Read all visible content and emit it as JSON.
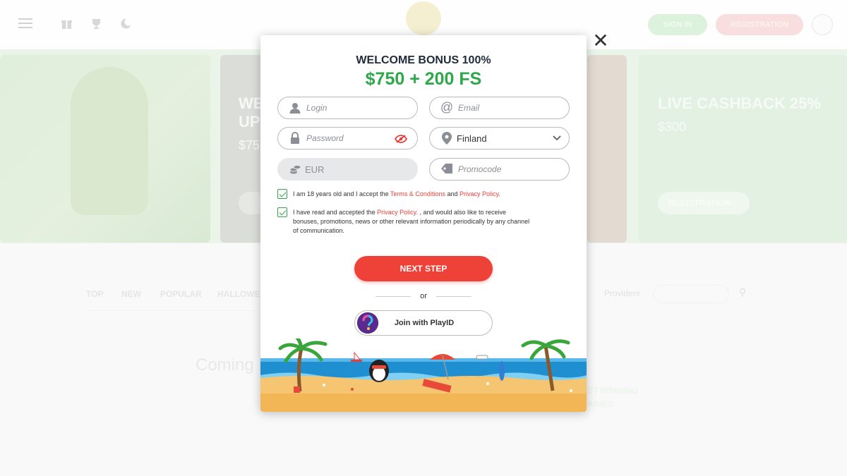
{
  "header": {
    "signin_label": "SIGN IN",
    "registration_label": "REGISTRATION"
  },
  "banners": {
    "b2_title_line1": "WE",
    "b2_title_line2": "UP",
    "b2_amount": "$75",
    "b4_title": "LIVE CASHBACK 25%",
    "b4_amount": "$300",
    "b4_button": "REGISTRATION"
  },
  "games": {
    "tabs": [
      "TOP",
      "NEW",
      "POPULAR",
      "HALLOWE"
    ],
    "providers_label": "Providers",
    "coming_text": "Coming",
    "winning_line1": "ST WINNING",
    "winning_line2": "ABIES"
  },
  "modal": {
    "title": "WELCOME BONUS 100%",
    "amount": "$750 + 200 FS",
    "fields": {
      "login_placeholder": "Login",
      "email_placeholder": "Email",
      "password_placeholder": "Password",
      "country_value": "Finland",
      "currency_value": "EUR",
      "promocode_placeholder": "Promocode"
    },
    "consent1": {
      "prefix": "I am 18 years old and I accept the ",
      "terms_link": "Terms & Conditions",
      "middle": " and ",
      "privacy_link": "Privacy Policy."
    },
    "consent2": {
      "prefix": "I have read and accepted the ",
      "privacy_link": "Privacy Policy.",
      "suffix": " , and would also like to receive bonuses, promotions, news or other relevant information periodically by any channel of communication."
    },
    "next_label": "NEXT STEP",
    "or_label": "or",
    "playid_label": "Join with PlayID"
  },
  "colors": {
    "accent_green": "#2ea84a",
    "accent_red": "#ee4137",
    "link_red": "#e8403a"
  },
  "icons": [
    "menu-icon",
    "gift-icon",
    "trophy-icon",
    "moon-icon",
    "close-icon",
    "user-icon",
    "at-icon",
    "lock-icon",
    "eye-hidden-icon",
    "location-pin-icon",
    "chevron-down-icon",
    "coins-icon",
    "tag-icon",
    "check-icon",
    "playid-logo-icon",
    "chat-icon"
  ]
}
